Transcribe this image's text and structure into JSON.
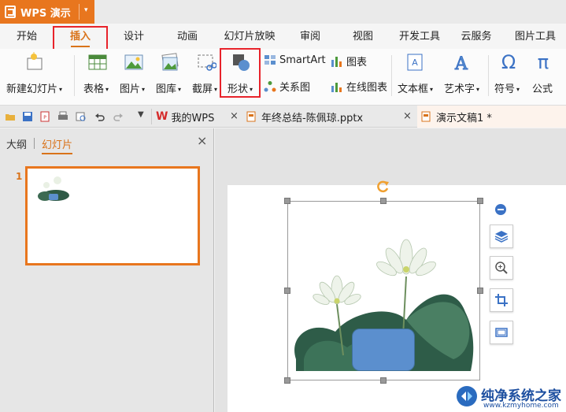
{
  "app": {
    "title": "WPS 演示"
  },
  "menu": {
    "tabs": [
      "开始",
      "插入",
      "设计",
      "动画",
      "幻灯片放映",
      "审阅",
      "视图",
      "开发工具",
      "云服务",
      "图片工具"
    ],
    "active_tab": "插入"
  },
  "ribbon": {
    "new_slide": "新建幻灯片",
    "table": "表格",
    "picture": "图片",
    "gallery": "图库",
    "screenshot": "截屏",
    "shape": "形状",
    "smartart": "SmartArt",
    "chart": "图表",
    "relation": "关系图",
    "online_chart": "在线图表",
    "textbox": "文本框",
    "wordart": "艺术字",
    "symbol": "符号",
    "formula": "公式"
  },
  "doc_tabs": [
    {
      "label": "我的WPS"
    },
    {
      "label": "年终总结-陈佩琼.pptx"
    },
    {
      "label": "演示文稿1 *"
    }
  ],
  "panel": {
    "tab_outline": "大纲",
    "tab_slides": "幻灯片",
    "close": "×",
    "slide_number": "1"
  },
  "watermark": {
    "title": "纯净系统之家",
    "url": "www.kzmyhome.com"
  },
  "colors": {
    "accent_orange": "#e8761e",
    "highlight_red": "#e8232b",
    "shape_blue": "#5b8fce"
  }
}
